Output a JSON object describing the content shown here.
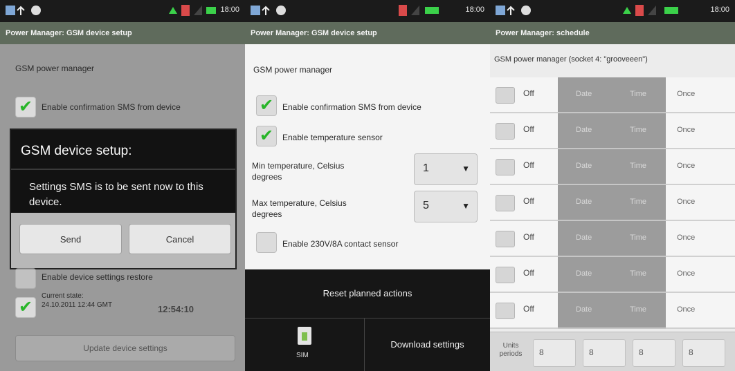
{
  "panel1": {
    "clock": "18:00",
    "title": "Power Manager: GSM device setup",
    "section_label": "GSM power manager",
    "checkbox1_label": "Enable confirmation SMS from device",
    "dialog": {
      "title": "GSM device setup:",
      "message": "Settings SMS is to be sent now to this device.",
      "send_label": "Send",
      "cancel_label": "Cancel"
    },
    "checkbox_lower_label": "Enable device settings restore",
    "status_block": {
      "text": "Current state: 24.10.2011 12:44 GMT",
      "value": "12:54:10"
    },
    "bottom_button_label": "Update device settings"
  },
  "panel2": {
    "clock": "18:00",
    "title": "Power Manager: GSM device setup",
    "section_label": "GSM power manager",
    "checkbox1_label": "Enable confirmation SMS from device",
    "checkbox2_label": "Enable temperature sensor",
    "min_temp_label": "Min temperature, Celsius degrees",
    "min_temp_value": "1",
    "max_temp_label": "Max temperature, Celsius degrees",
    "max_temp_value": "5",
    "checkbox3_label": "Enable 230V/8A contact sensor",
    "menu": {
      "top_label": "Reset planned actions",
      "sd_label": "SIM",
      "download_label": "Download settings"
    }
  },
  "panel3": {
    "clock": "18:00",
    "title": "Power Manager: schedule",
    "note": "GSM power manager (socket 4: \"grooveeen\")",
    "rows": [
      {
        "off": "Off",
        "mid1": "Date",
        "mid2": "Time",
        "end": "Once"
      },
      {
        "off": "Off",
        "mid1": "Date",
        "mid2": "Time",
        "end": "Once"
      },
      {
        "off": "Off",
        "mid1": "Date",
        "mid2": "Time",
        "end": "Once"
      },
      {
        "off": "Off",
        "mid1": "Date",
        "mid2": "Time",
        "end": "Once"
      },
      {
        "off": "Off",
        "mid1": "Date",
        "mid2": "Time",
        "end": "Once"
      },
      {
        "off": "Off",
        "mid1": "Date",
        "mid2": "Time",
        "end": "Once"
      },
      {
        "off": "Off",
        "mid1": "Date",
        "mid2": "Time",
        "end": "Once"
      }
    ],
    "bottom": {
      "label": "Units periods",
      "cells": [
        "8",
        "8",
        "8",
        "8"
      ]
    }
  }
}
